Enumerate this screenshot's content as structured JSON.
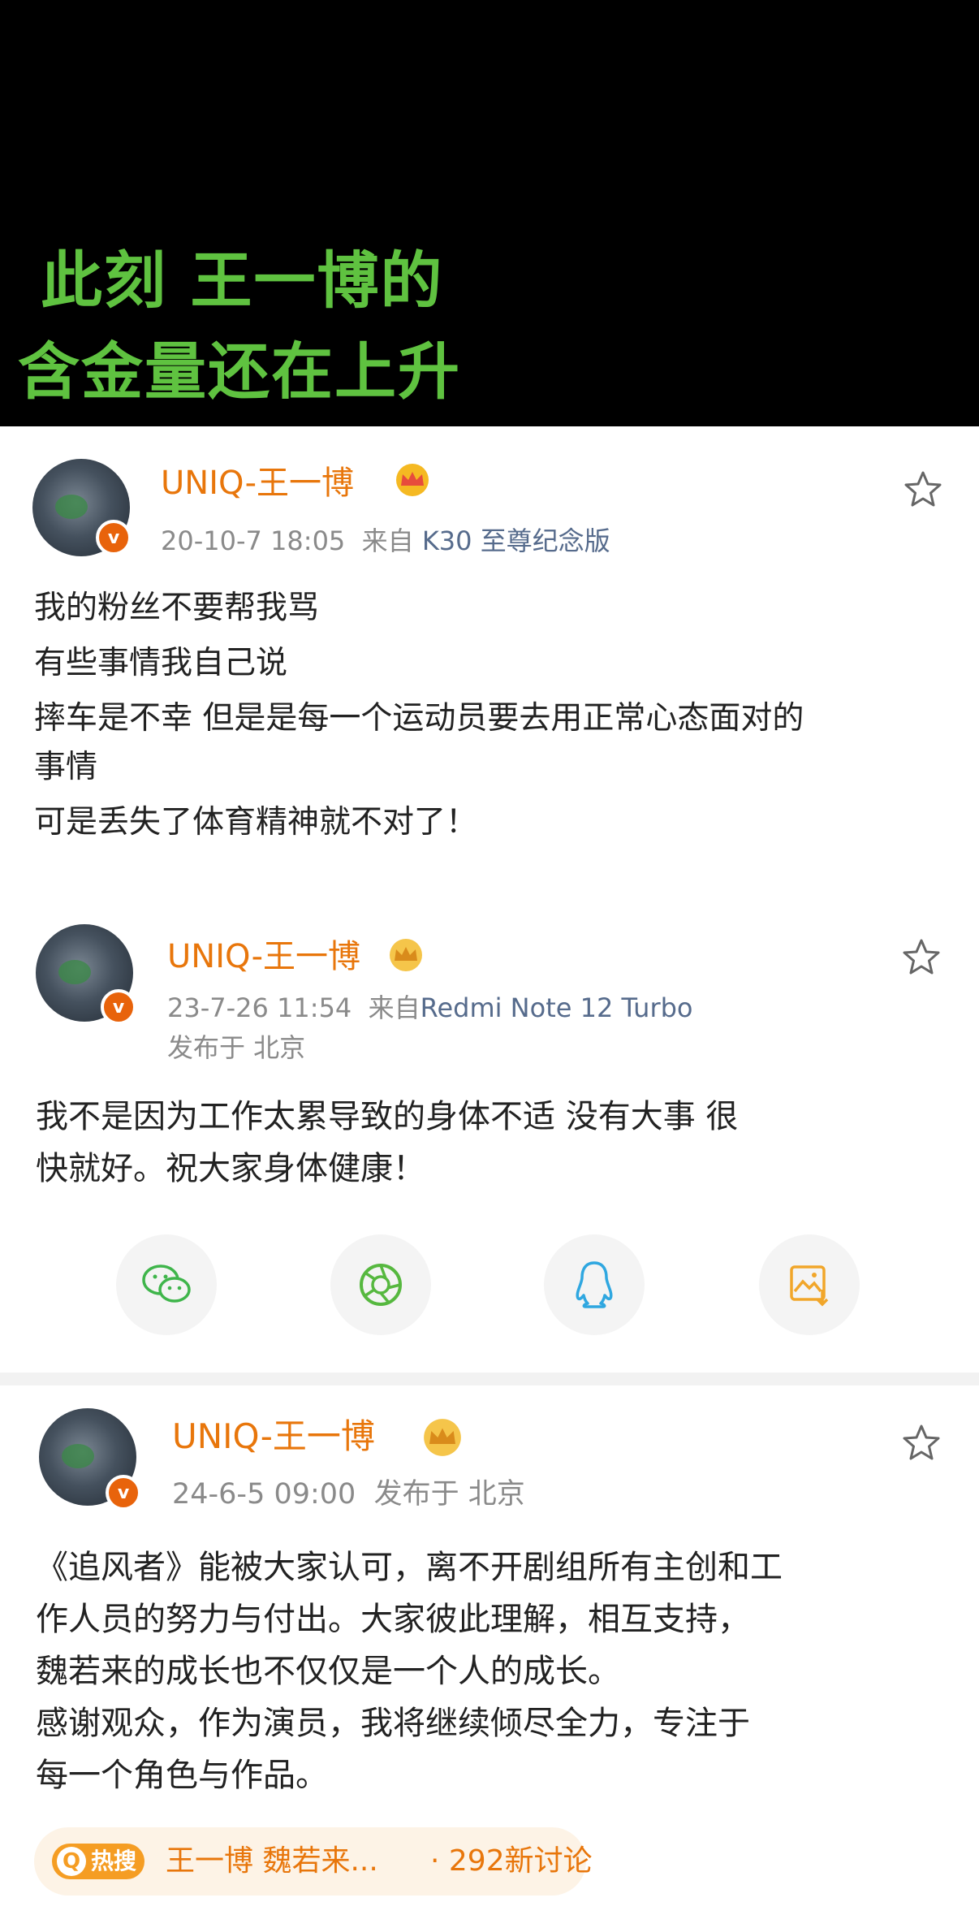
{
  "headline": {
    "line1": "此刻 王一博的",
    "line2": "含金量还在上升"
  },
  "posts": [
    {
      "username": "UNIQ-王一博",
      "timestamp": "20-10-7 18:05",
      "from_label": "来自",
      "source": "K30 至尊纪念版",
      "location": "",
      "lines": [
        "我的粉丝不要帮我骂",
        "有些事情我自己说",
        "摔车是不幸 但是是每一个运动员要去用正常心态面对的",
        "事情",
        "可是丢失了体育精神就不对了！"
      ]
    },
    {
      "username": "UNIQ-王一博",
      "timestamp": "23-7-26 11:54",
      "from_label": "来自",
      "source": "Redmi Note 12 Turbo",
      "location": "发布于 北京",
      "lines": [
        "我不是因为工作太累导致的身体不适 没有大事 很",
        "快就好。祝大家身体健康！"
      ]
    },
    {
      "username": "UNIQ-王一博",
      "timestamp": "24-6-5 09:00",
      "location_inline": "发布于 北京",
      "lines": [
        "《追风者》能被大家认可，离不开剧组所有主创和工",
        "作人员的努力与付出。大家彼此理解，相互支持，",
        "魏若来的成长也不仅仅是一个人的成长。",
        "感谢观众，作为演员，我将继续倾尽全力，专注于",
        "每一个角色与作品。"
      ]
    }
  ],
  "verified_badge": "v",
  "share_icons": [
    "wechat-icon",
    "moments-icon",
    "qq-icon",
    "save-image-icon"
  ],
  "hot_search": {
    "badge": "热搜",
    "title": "王一博 魏若来...",
    "count": "· 292新讨论"
  },
  "colors": {
    "headline": "#5fc240",
    "username": "#e8760b",
    "meta": "#8a8a8a",
    "source": "#566b8c",
    "text": "#222222"
  }
}
